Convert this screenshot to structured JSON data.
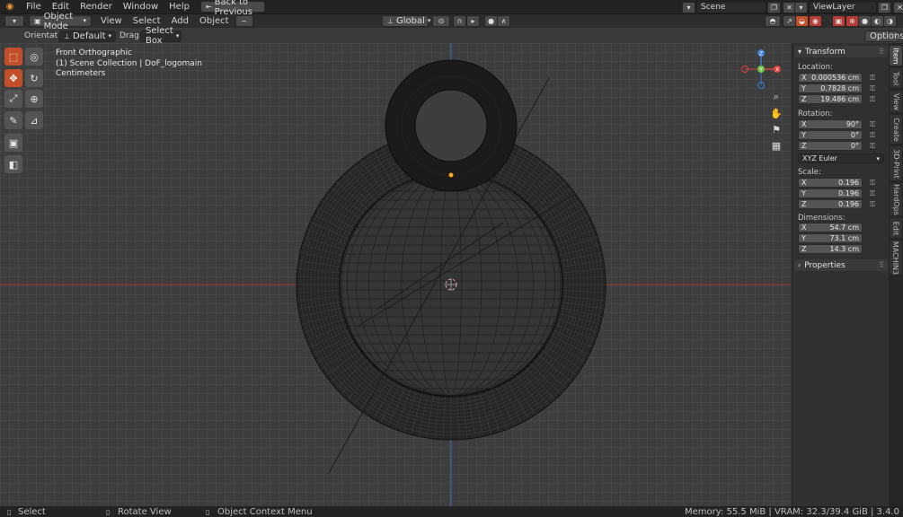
{
  "topbar": {
    "menus": [
      "File",
      "Edit",
      "Render",
      "Window",
      "Help"
    ],
    "back_button": "Back to Previous",
    "scene": "Scene",
    "view_layer": "ViewLayer"
  },
  "toolbar": {
    "mode": "Object Mode",
    "menus": [
      "View",
      "Select",
      "Add",
      "Object"
    ],
    "transform_orientation": "Global"
  },
  "header": {
    "orientation_label": "Orientation:",
    "orientation_value": "Default",
    "drag_label": "Drag:",
    "drag_value": "Select Box",
    "options": "Options"
  },
  "viewport": {
    "view_name": "Front Orthographic",
    "collection": "(1) Scene Collection | DoF_logomain",
    "units": "Centimeters"
  },
  "gizmo": {
    "x": "X",
    "y": "Y",
    "z": "Z"
  },
  "npanel": {
    "transform_title": "Transform",
    "location_label": "Location:",
    "location": [
      {
        "axis": "X",
        "value": "0.000536 cm"
      },
      {
        "axis": "Y",
        "value": "0.7828 cm"
      },
      {
        "axis": "Z",
        "value": "19.486 cm"
      }
    ],
    "rotation_label": "Rotation:",
    "rotation": [
      {
        "axis": "X",
        "value": "90°"
      },
      {
        "axis": "Y",
        "value": "0°"
      },
      {
        "axis": "Z",
        "value": "0°"
      }
    ],
    "rotation_mode": "XYZ Euler",
    "scale_label": "Scale:",
    "scale": [
      {
        "axis": "X",
        "value": "0.196"
      },
      {
        "axis": "Y",
        "value": "0.196"
      },
      {
        "axis": "Z",
        "value": "0.196"
      }
    ],
    "dimensions_label": "Dimensions:",
    "dimensions": [
      {
        "axis": "X",
        "value": "54.7 cm"
      },
      {
        "axis": "Y",
        "value": "73.1 cm"
      },
      {
        "axis": "Z",
        "value": "14.3 cm"
      }
    ],
    "properties_title": "Properties"
  },
  "tabs": [
    "Item",
    "Tool",
    "View",
    "Create",
    "3D-Print",
    "HardOps",
    "Edit",
    "MACHIN3"
  ],
  "statusbar": {
    "select": "Select",
    "rotate": "Rotate View",
    "context": "Object Context Menu",
    "stats": "Memory: 55.5 MiB | VRAM: 32.3/39.4 GiB | 3.4.0"
  },
  "colors": {
    "accent": "#c24e2a",
    "x_axis": "#d9433f",
    "y_axis": "#6cc24a",
    "z_axis": "#3c7fd6",
    "origin": "#f5a623"
  }
}
